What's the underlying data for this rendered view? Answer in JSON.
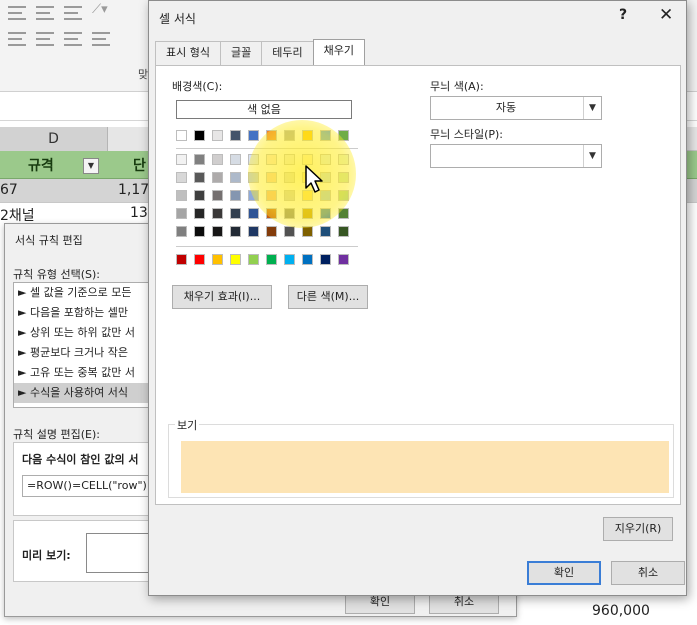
{
  "colors": {
    "accent": "#3a7dd6",
    "table_header": "#9bc98b",
    "sample_fill": "#fde4b4",
    "cursor_highlight": "#ffec28"
  },
  "excel": {
    "ribbon_ghost": "맞",
    "col_d": "D",
    "header_d": "규격",
    "header_e": "단",
    "row1_d": "67",
    "row1_e": "1,17",
    "row2_d": "2채널",
    "row2_e": "13",
    "bottom_value": "960,000"
  },
  "rule_dialog": {
    "title": "서식 규칙 편집",
    "type_label": "규칙 유형 선택(S):",
    "rule_types": [
      "► 셀 값을 기준으로 모든",
      "► 다음을 포함하는 셀만",
      "► 상위 또는 하위 값만 서",
      "► 평균보다 크거나 작은",
      "► 고유 또는 중복 값만 서",
      "► 수식을 사용하여 서식"
    ],
    "desc_label": "규칙 설명 편집(E):",
    "desc_text": "다음 수식이 참인 값의 서",
    "formula": "=ROW()=CELL(\"row\")",
    "preview_label": "미리 보기:",
    "ok": "확인",
    "cancel": "취소"
  },
  "format_dialog": {
    "title": "셀 서식",
    "help": "?",
    "close": "✕",
    "tabs": [
      "표시 형식",
      "글꼴",
      "테두리",
      "채우기"
    ],
    "active_tab": "채우기",
    "background_color_label": "배경색(C):",
    "no_color": "색 없음",
    "fill_effects": "채우기 효과(I)...",
    "more_colors": "다른 색(M)...",
    "pattern_color_label": "무늬 색(A):",
    "pattern_color_value": "자동",
    "pattern_style_label": "무늬 스타일(P):",
    "sample_label": "보기",
    "clear": "지우기(R)",
    "ok": "확인",
    "cancel": "취소",
    "theme_colors": [
      [
        "#ffffff",
        "#000000",
        "#e7e6e6",
        "#44546a",
        "#4472c4",
        "#ed7d31",
        "#a5a5a5",
        "#ffc000",
        "#5b9bd5",
        "#70ad47"
      ],
      [
        "#f2f2f2",
        "#808080",
        "#d0cece",
        "#d6dce4",
        "#d9e2f3",
        "#fbe5d5",
        "#ededed",
        "#fff2cc",
        "#deebf6",
        "#e2efd9"
      ],
      [
        "#d8d8d8",
        "#595959",
        "#aeabab",
        "#adb9ca",
        "#b4c6e7",
        "#f7cbac",
        "#dbdbdb",
        "#fee599",
        "#bdd7ee",
        "#c5e0b3"
      ],
      [
        "#bfbfbf",
        "#3f3f3f",
        "#757070",
        "#8496b0",
        "#8eaadb",
        "#f4b183",
        "#c9c9c9",
        "#ffd965",
        "#9cc3e5",
        "#a8d08d"
      ],
      [
        "#a5a5a5",
        "#262626",
        "#3a3838",
        "#323f4f",
        "#2f5496",
        "#c55a11",
        "#7b7b7b",
        "#bf9000",
        "#2e75b5",
        "#538135"
      ],
      [
        "#7f7f7f",
        "#0c0c0c",
        "#171616",
        "#222a35",
        "#1f3864",
        "#833c0b",
        "#525252",
        "#7f6000",
        "#1e4e79",
        "#375623"
      ]
    ],
    "standard_colors": [
      "#c00000",
      "#ff0000",
      "#ffc000",
      "#ffff00",
      "#92d050",
      "#00b050",
      "#00b0f0",
      "#0070c0",
      "#002060",
      "#7030a0"
    ]
  }
}
